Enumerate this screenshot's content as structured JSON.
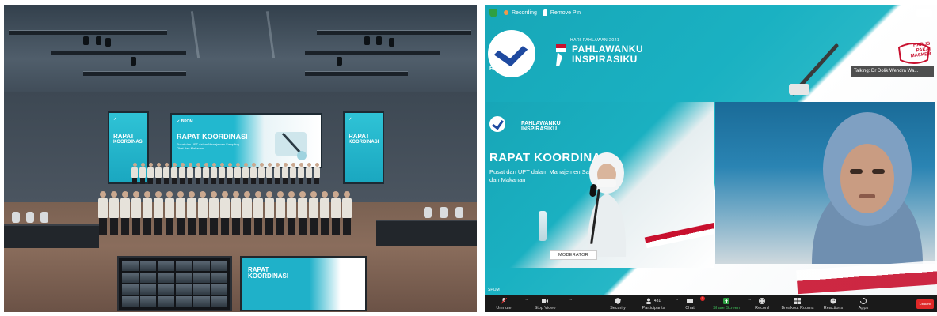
{
  "left_photo": {
    "main_screen": {
      "title_line1": "RAPAT KOORDINASI",
      "subtitle": "Pusat dan UPT dalam Manajemen Sampling Obat dan Makanan"
    },
    "side_screen": {
      "title_line1": "RAPAT",
      "title_line2": "KOORDINASI"
    },
    "monitor_screen": {
      "title_line1": "RAPAT",
      "title_line2": "KOORDINASI"
    }
  },
  "zoom": {
    "topbar": {
      "recording_label": "Recording",
      "remove_pin_label": "Remove Pin"
    },
    "slide": {
      "org_name": "BADAN POM",
      "event": "HARI PAHLAWAN 2021",
      "theme_line1": "PAHLAWANKU",
      "theme_line2": "INSPIRASIKU",
      "mask_line1": "HARUS",
      "mask_line2": "PAKAI",
      "mask_line3": "MASKER"
    },
    "talking_banner": "Talking: Dr Dolik Wendra Wa...",
    "left_tile": {
      "theme_line1": "PAHLAWANKU",
      "theme_line2": "INSPIRASIKU",
      "meeting_title": "RAPAT KOORDINASI",
      "meeting_subtitle": "Pusat dan UPT dalam Manajemen Sampling Obat dan Makanan",
      "moderator_sign": "MODERATOR"
    },
    "bottom_label": "SPOM",
    "toolbar": {
      "items": [
        {
          "label": "Unmute",
          "icon": "mic-muted-icon"
        },
        {
          "label": "Stop Video",
          "icon": "video-icon"
        },
        {
          "label": "Security",
          "icon": "security-shield-icon"
        },
        {
          "label": "Participants",
          "icon": "participants-icon",
          "count": "431"
        },
        {
          "label": "Chat",
          "icon": "chat-icon",
          "badge": "1"
        },
        {
          "label": "Share Screen",
          "icon": "share-screen-icon"
        },
        {
          "label": "Record",
          "icon": "record-icon"
        },
        {
          "label": "Breakout Rooms",
          "icon": "breakout-rooms-icon"
        },
        {
          "label": "Reactions",
          "icon": "reactions-icon"
        },
        {
          "label": "Apps",
          "icon": "apps-icon"
        }
      ],
      "leave_label": "Leave"
    },
    "colors": {
      "slide_teal": "#1ab1c2",
      "leave_red": "#e02828",
      "share_green": "#2ea043",
      "toolbar_bg": "#1a1a1a"
    }
  }
}
